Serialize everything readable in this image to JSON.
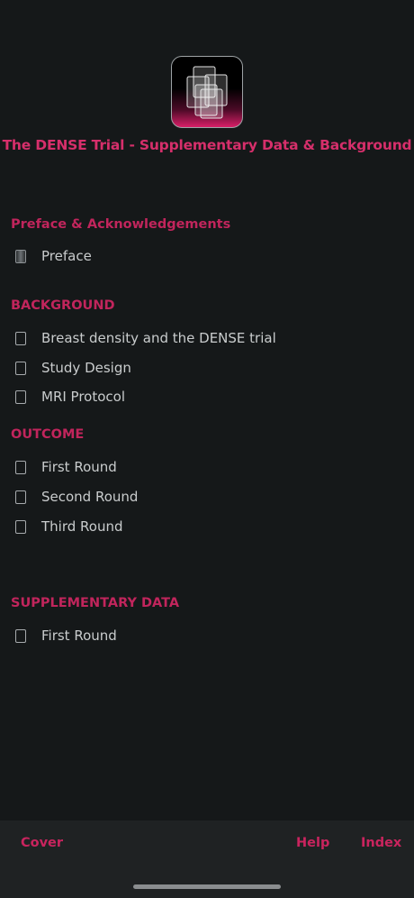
{
  "app": {
    "title": "The DENSE Trial - Supplementary Data & Background",
    "icon": "stacked-pages-icon"
  },
  "sections": [
    {
      "heading": "Preface & Acknowledgements",
      "items": [
        {
          "label": "Preface",
          "active": true
        }
      ]
    },
    {
      "heading": "BACKGROUND",
      "items": [
        {
          "label": "Breast density and the DENSE trial",
          "active": false
        },
        {
          "label": "Study Design",
          "active": false
        },
        {
          "label": "MRI Protocol",
          "active": false
        }
      ]
    },
    {
      "heading": "OUTCOME",
      "items": [
        {
          "label": "First Round",
          "active": false
        },
        {
          "label": "Second Round",
          "active": false
        },
        {
          "label": "Third Round",
          "active": false
        }
      ]
    },
    {
      "heading": "SUPPLEMENTARY DATA",
      "items": [
        {
          "label": "First Round",
          "active": false
        }
      ]
    }
  ],
  "bottom_bar": {
    "cover": "Cover",
    "help": "Help",
    "index": "Index"
  },
  "colors": {
    "background": "#151819",
    "accent": "#d62f6b",
    "heading": "#c1255c",
    "text": "#c9cccd",
    "bottom_bar": "#1f2223"
  }
}
